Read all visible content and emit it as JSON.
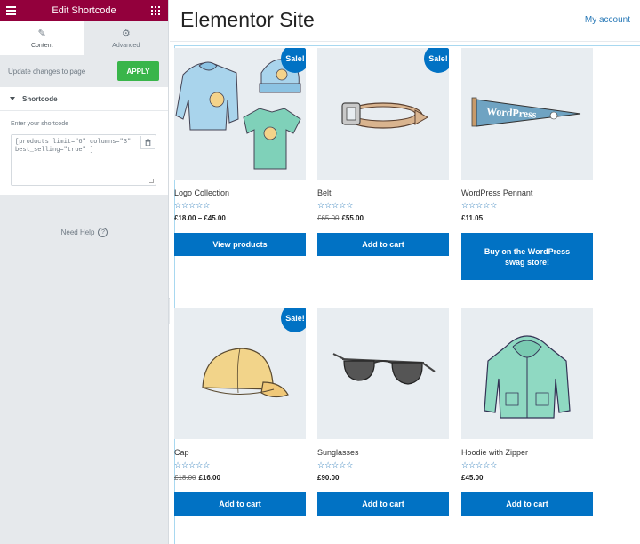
{
  "panel": {
    "title": "Edit Shortcode",
    "tabs": [
      {
        "label": "Content",
        "icon": "pencil-icon",
        "active": true
      },
      {
        "label": "Advanced",
        "icon": "gear-icon",
        "active": false
      }
    ],
    "update_label": "Update changes to page",
    "apply_label": "APPLY",
    "section_title": "Shortcode",
    "field_label": "Enter your shortcode",
    "shortcode_value": "[products limit=\"6\" columns=\"3\" best_selling=\"true\" ]",
    "need_help": "Need Help",
    "help_icon_text": "?"
  },
  "site": {
    "title": "Elementor Site",
    "my_account": "My account"
  },
  "products": [
    {
      "name": "Logo Collection",
      "price": "£18.00 – £45.00",
      "old_price": "",
      "sale": true,
      "button": "View products"
    },
    {
      "name": "Belt",
      "price": "£55.00",
      "old_price": "£65.00",
      "sale": true,
      "button": "Add to cart"
    },
    {
      "name": "WordPress Pennant",
      "price": "£11.05",
      "old_price": "",
      "sale": false,
      "button": "Buy on the WordPress swag store!"
    },
    {
      "name": "Cap",
      "price": "£16.00",
      "old_price": "£18.00",
      "sale": true,
      "button": "Add to cart"
    },
    {
      "name": "Sunglasses",
      "price": "£90.00",
      "old_price": "",
      "sale": false,
      "button": "Add to cart"
    },
    {
      "name": "Hoodie with Zipper",
      "price": "£45.00",
      "old_price": "",
      "sale": false,
      "button": "Add to cart"
    }
  ],
  "sale_label": "Sale!",
  "stars": "☆☆☆☆☆",
  "pennant_text": "WordPress",
  "colors": {
    "brand_primary": "#93003c",
    "apply_green": "#39b54a",
    "button_blue": "#0172c4",
    "image_bg": "#e8edf1"
  }
}
